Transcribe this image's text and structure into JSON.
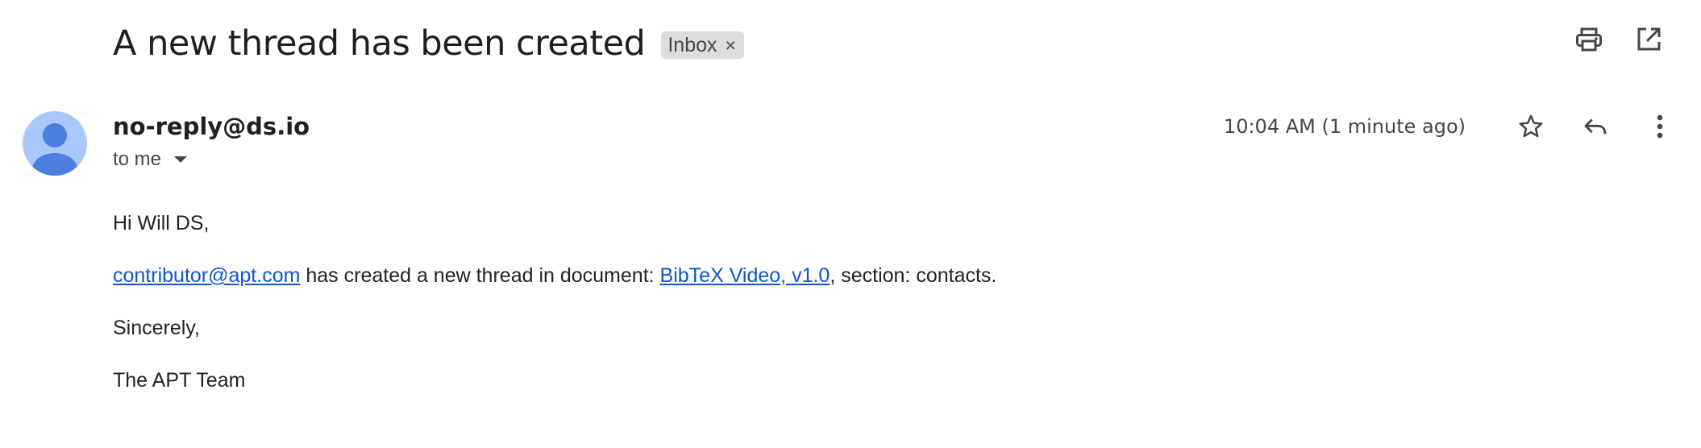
{
  "message": {
    "subject": "A new thread has been created",
    "label": "Inbox",
    "label_remove_glyph": "×"
  },
  "sender": {
    "name": "no-reply@ds.io",
    "recipients": "to me",
    "timestamp": "10:04 AM (1 minute ago)"
  },
  "body": {
    "greeting": "Hi Will DS,",
    "contributor_link": "contributor@apt.com",
    "middle_text": " has created a new thread in document: ",
    "document_link": "BibTeX Video, v1.0",
    "section_text": ", section: contacts.",
    "closing": "Sincerely,",
    "signature": "The APT Team"
  },
  "icons": {
    "print": "print-icon",
    "open_new_window": "open-in-new-window-icon",
    "star": "star-icon",
    "reply": "reply-icon",
    "more": "more-vert-icon",
    "avatar": "default-avatar-icon",
    "dropdown": "caret-down-icon"
  },
  "colors": {
    "link": "#1155cc",
    "avatar_bg": "#a8c7fa",
    "avatar_fg": "#4b7fe0",
    "chip_bg": "#dddddd",
    "icon": "#444746"
  }
}
